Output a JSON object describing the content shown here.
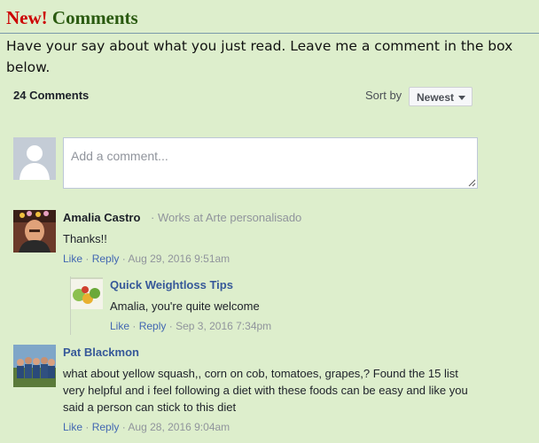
{
  "header": {
    "title_new": "New!",
    "title_word": "Comments"
  },
  "intro": "Have your say about what you just read. Leave me a comment in the box below.",
  "toolbar": {
    "count": "24 Comments",
    "sort_label": "Sort by",
    "sort_value": "Newest"
  },
  "composer": {
    "placeholder": "Add a comment..."
  },
  "comments": [
    {
      "author": "Amalia Castro",
      "affiliation": "· Works at Arte personalisado",
      "text": "Thanks!!",
      "like": "Like",
      "reply": "Reply",
      "timestamp": "Aug 29, 2016 9:51am",
      "reply_item": {
        "author": "Quick Weightloss Tips",
        "text": "Amalia, you're quite welcome",
        "like": "Like",
        "reply": "Reply",
        "timestamp": "Sep 3, 2016 7:34pm"
      }
    },
    {
      "author": "Pat Blackmon",
      "text": "what about yellow squash,, corn on cob, tomatoes, grapes,? Found the 15 list very helpful and i feel following a diet with these foods can be easy and like you said a person can stick to this diet",
      "like": "Like",
      "reply": "Reply",
      "timestamp": "Aug 28, 2016 9:04am"
    }
  ],
  "sep": "·",
  "colors": {
    "page_bg": "#ddeecc",
    "title_new": "#cc0000",
    "title_word": "#2a5a10",
    "link": "#4267b2",
    "author_link": "#365899"
  }
}
